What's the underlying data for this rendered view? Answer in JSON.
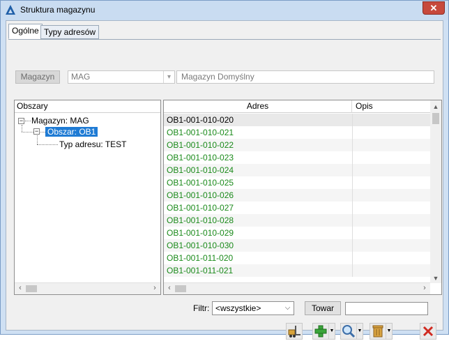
{
  "window": {
    "title": "Struktura magazynu",
    "close_glyph": "✕"
  },
  "tabs": [
    {
      "label": "Ogólne",
      "active": true
    },
    {
      "label": "Typy adresów",
      "active": false
    }
  ],
  "warehouse": {
    "button_label": "Magazyn",
    "combo_value": "MAG",
    "description": "Magazyn Domyślny"
  },
  "tree": {
    "header": "Obszary",
    "nodes": [
      {
        "label": "Magazyn: MAG",
        "level": 0,
        "expanded": true
      },
      {
        "label": "Obszar: OB1",
        "level": 1,
        "expanded": true,
        "selected": true
      },
      {
        "label": "Typ adresu: TEST",
        "level": 2
      }
    ]
  },
  "grid": {
    "columns": [
      "Adres",
      "Opis"
    ],
    "rows": [
      "OB1-001-010-020",
      "OB1-001-010-021",
      "OB1-001-010-022",
      "OB1-001-010-023",
      "OB1-001-010-024",
      "OB1-001-010-025",
      "OB1-001-010-026",
      "OB1-001-010-027",
      "OB1-001-010-028",
      "OB1-001-010-029",
      "OB1-001-010-030",
      "OB1-001-011-020",
      "OB1-001-011-021"
    ]
  },
  "filter": {
    "label": "Filtr:",
    "value": "<wszystkie>",
    "towar_button": "Towar",
    "towar_value": ""
  },
  "toolbar": [
    {
      "name": "forklift-icon"
    },
    {
      "name": "add-icon"
    },
    {
      "name": "magnifier-icon"
    },
    {
      "name": "trash-icon"
    },
    {
      "name": "close-icon"
    }
  ],
  "colors": {
    "selection": "#1f7bd4",
    "green_text": "#1a8a1a",
    "close_red": "#d02a20"
  }
}
